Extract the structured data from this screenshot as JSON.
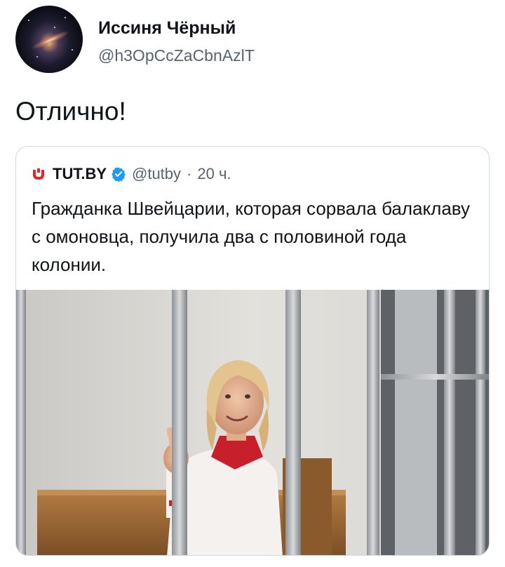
{
  "author": {
    "display_name": "Иссиня Чёрный",
    "handle": "@h3OpCcZaCbnAzlT",
    "avatar_icon": "galaxy-avatar"
  },
  "tweet": {
    "text": "Отлично!"
  },
  "quoted_tweet": {
    "source_icon": "tutby-logo-icon",
    "source_name": "TUT.BY",
    "verified_icon": "verified-badge-icon",
    "handle": "@tutby",
    "separator": "·",
    "time": "20 ч.",
    "text": "Гражданка Швейцарии, которая сорвала балаклаву с омоновца, получила два с половиной года колонии.",
    "image": "photo-woman-behind-bars"
  },
  "colors": {
    "text_primary": "#0f1419",
    "text_secondary": "#566370",
    "verified_blue": "#1d9bf0",
    "border": "#cfd9de",
    "tutby_red": "#e0262b"
  }
}
